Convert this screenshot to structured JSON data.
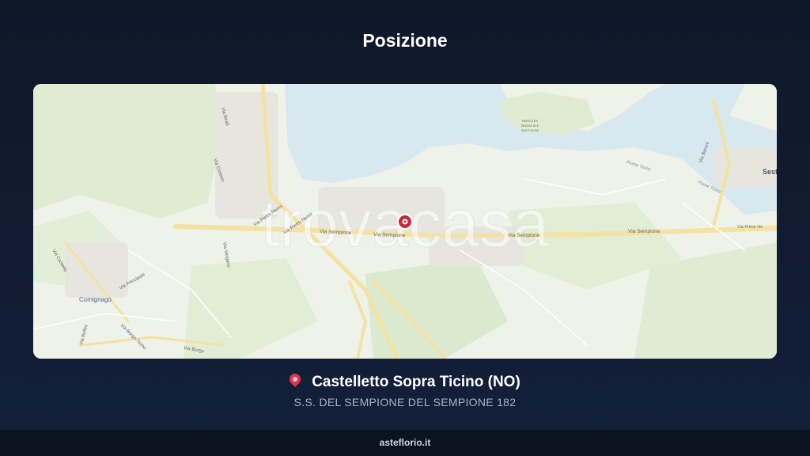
{
  "page": {
    "title": "Posizione",
    "location_name": "Castelletto Sopra Ticino (NO)",
    "address": "S.S. DEL SEMPIONE DEL SEMPIONE 182",
    "footer": "asteflorio.it"
  },
  "map": {
    "watermark": "trovacasa",
    "labels": {
      "comignago": "Comignago",
      "sesto": "Sest",
      "parco": "PARCO EX",
      "sindacale": "SINDACALE",
      "santanna": "SANT'ANNA",
      "via_sempione_1": "Via Sempione",
      "via_sempione_2": "Via Sempione",
      "via_sempione_3": "Via Sempione",
      "via_sempione_4": "Via Sempione",
      "via_primo_ho": "Via Primo Ho",
      "via_pietro_nenni_1": "Via Pietro Nenni",
      "via_pietro_nenni_2": "Via Pietro Nenni",
      "via_principale": "Via Principale",
      "via_borgo_ticino": "Via Borgo Ticino",
      "via_borgo": "Via Borgo",
      "via_bellini": "Via Bellini",
      "via_beati": "Via Beati",
      "via_cimiero": "Via Cimiero",
      "via_castello": "Via Castello",
      "via_baroni": "Via Baroni",
      "fiume_ticino_1": "Fiume Ticino",
      "fiume_ticino_2": "Fiume Ticino",
      "via_vergano": "Via Vergano"
    },
    "colors": {
      "water": "#d7e8ee",
      "land": "#eef2e8",
      "green": "#dcead0",
      "road": "#f5e7a8",
      "marker": "#c8283c"
    }
  }
}
